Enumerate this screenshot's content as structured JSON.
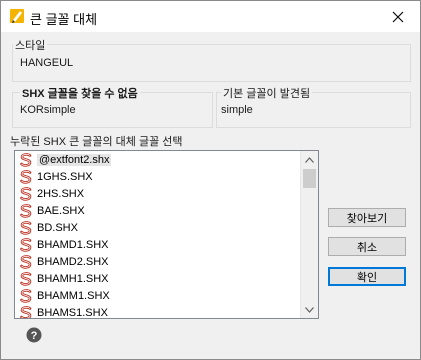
{
  "window": {
    "title": "큰 글꼴 대체"
  },
  "style_group": {
    "label": "스타일",
    "value": "HANGEUL"
  },
  "missing_group": {
    "label": "SHX 글꼴을 찾을 수 없음",
    "value": "KORsimple"
  },
  "found_group": {
    "label": "기본 글꼴이 발견됨",
    "value": "simple"
  },
  "list": {
    "caption": "누락된 SHX 큰 글꼴의 대체 글꼴 선택",
    "items": [
      "@extfont2.shx",
      "1GHS.SHX",
      "2HS.SHX",
      "BAE.SHX",
      "BD.SHX",
      "BHAMD1.SHX",
      "BHAMD2.SHX",
      "BHAMH1.SHX",
      "BHAMM1.SHX",
      "BHAMS1.SHX"
    ],
    "selected_index": 0
  },
  "buttons": {
    "browse": "찾아보기",
    "cancel": "취소",
    "ok": "확인"
  },
  "colors": {
    "accent": "#0078d7",
    "shx_icon": "#c0392b"
  },
  "icons": {
    "app": "autocad-app-icon",
    "close": "close-icon",
    "help": "help-icon",
    "list_item": "shx-font-icon"
  }
}
